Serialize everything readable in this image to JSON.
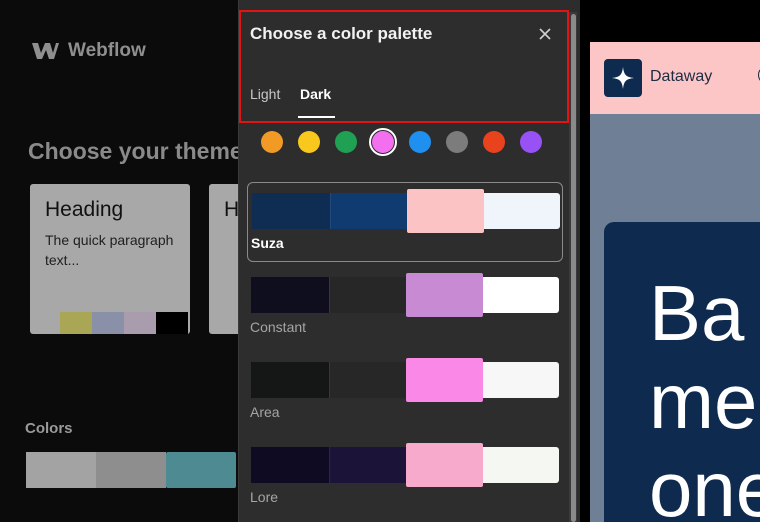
{
  "left_app": {
    "logo_text": "Webflow",
    "heading": "Choose your theme",
    "cards": [
      {
        "heading": "Heading",
        "paragraph": "The quick paragraph text...",
        "swatches": [
          "#a9a756",
          "#8a90a8",
          "#a99cac",
          "#000000"
        ]
      },
      {
        "heading": "H",
        "paragraph": "",
        "swatches": []
      }
    ],
    "colors_label": "Colors",
    "colors_bar": [
      "#a3a3a3",
      "#8e8e8e",
      "#4d8a92"
    ]
  },
  "modal": {
    "title": "Choose a color palette",
    "tabs": [
      {
        "label": "Light",
        "active": false
      },
      {
        "label": "Dark",
        "active": true
      }
    ],
    "color_dots": [
      {
        "icon": "orange-dot",
        "color": "#f29a26",
        "selected": false
      },
      {
        "icon": "yellow-dot",
        "color": "#f8c81c",
        "selected": false
      },
      {
        "icon": "green-dot",
        "color": "#20a052",
        "selected": false
      },
      {
        "icon": "pink-dot",
        "color": "#f36ff0",
        "selected": true
      },
      {
        "icon": "blue-dot",
        "color": "#1f8ff0",
        "selected": false
      },
      {
        "icon": "gray-dot",
        "color": "#7c7c7c",
        "selected": false
      },
      {
        "icon": "red-dot",
        "color": "#e9431d",
        "selected": false
      },
      {
        "icon": "purple-dot",
        "color": "#9751f4",
        "selected": false
      }
    ],
    "palettes": [
      {
        "name": "Suza",
        "selected": true,
        "colors": [
          "#0f2d52",
          "#103b70",
          "#fbc3c3",
          "#eff5fb"
        ]
      },
      {
        "name": "Constant",
        "selected": false,
        "colors": [
          "#0e0e1e",
          "#272727",
          "#c98ad4",
          "#ffffff"
        ]
      },
      {
        "name": "Area",
        "selected": false,
        "colors": [
          "#151616",
          "#272727",
          "#f988e6",
          "#f7f7f7"
        ]
      },
      {
        "name": "Lore",
        "selected": false,
        "colors": [
          "#0f0b22",
          "#1c1438",
          "#f8aacc",
          "#f5f7f2"
        ]
      }
    ]
  },
  "preview": {
    "brand_name": "Dataway",
    "header_color": "#fcc6c7",
    "hero_lines": [
      "Ba",
      "me",
      "one"
    ],
    "hero_color": "#0e2a4e"
  }
}
